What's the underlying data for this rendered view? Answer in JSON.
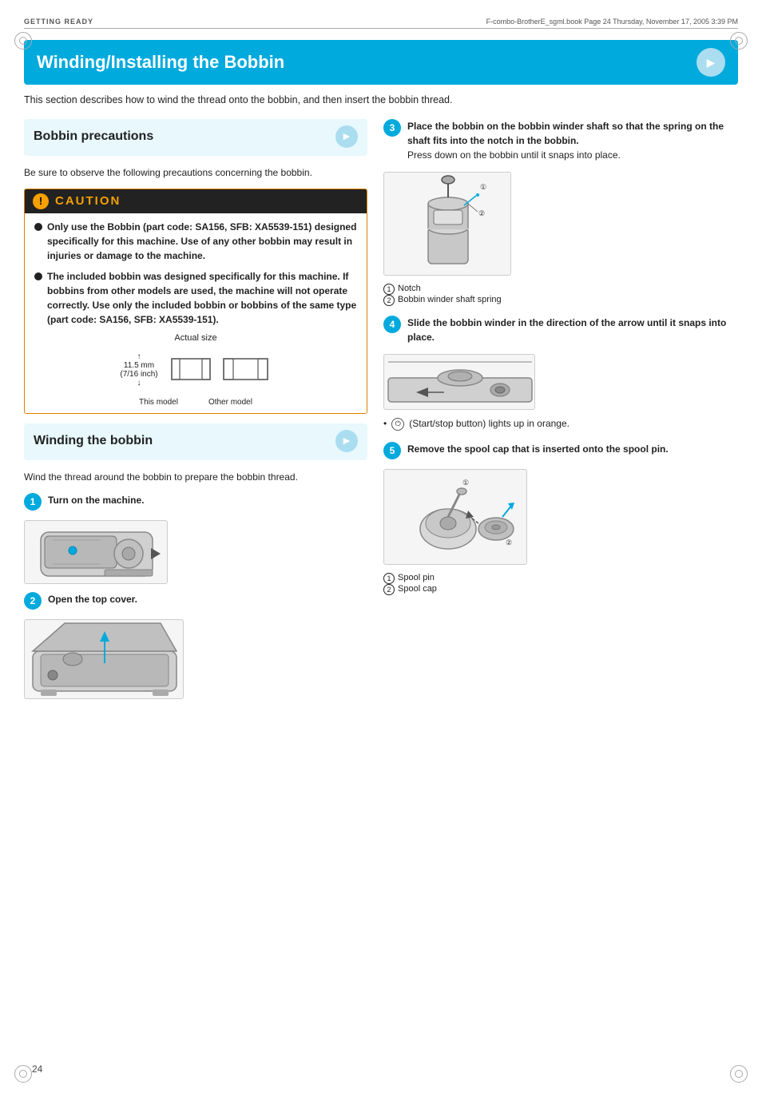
{
  "header": {
    "label": "GETTING READY",
    "file": "F-combo-BrotherE_sgml.book  Page 24  Thursday, November 17, 2005  3:39 PM"
  },
  "main_title": "Winding/Installing the Bobbin",
  "intro": "This section describes how to wind the thread onto the bobbin, and then insert the bobbin thread.",
  "bobbin_precautions": {
    "title": "Bobbin precautions",
    "body": "Be sure to observe the following precautions concerning the bobbin.",
    "caution_label": "CAUTION",
    "items": [
      "Only use the Bobbin (part code: SA156, SFB: XA5539-151) designed specifically for this machine. Use of any other bobbin may result in injuries or damage to the machine.",
      "The included bobbin was designed specifically for this machine. If bobbins from other models are used, the machine will not operate correctly. Use only the included bobbin or bobbins of the same type (part code: SA156, SFB: XA5539-151)."
    ],
    "actual_size": "Actual size",
    "dimension": "11.5 mm\n(7/16 inch)",
    "this_model": "This model",
    "other_model": "Other model"
  },
  "winding_the_bobbin": {
    "title": "Winding the bobbin",
    "body": "Wind the thread around the bobbin to prepare the bobbin thread.",
    "steps": [
      {
        "num": "1",
        "text": "Turn on the machine."
      },
      {
        "num": "2",
        "text": "Open the top cover."
      }
    ]
  },
  "right_steps": [
    {
      "num": "3",
      "text_bold": "Place the bobbin on the bobbin winder shaft so that the spring on the shaft fits into the notch in the bobbin.",
      "text_normal": "Press down on the bobbin until it snaps into place.",
      "labels": [
        {
          "num": "1",
          "text": "Notch"
        },
        {
          "num": "2",
          "text": "Bobbin winder shaft spring"
        }
      ]
    },
    {
      "num": "4",
      "text_bold": "Slide the bobbin winder in the direction of the arrow until it snaps into place.",
      "note": "(Start/stop button) lights up in orange.",
      "labels": []
    },
    {
      "num": "5",
      "text_bold": "Remove the spool cap that is inserted onto the spool pin.",
      "labels": [
        {
          "num": "1",
          "text": "Spool pin"
        },
        {
          "num": "2",
          "text": "Spool cap"
        }
      ]
    }
  ],
  "page_number": "24"
}
